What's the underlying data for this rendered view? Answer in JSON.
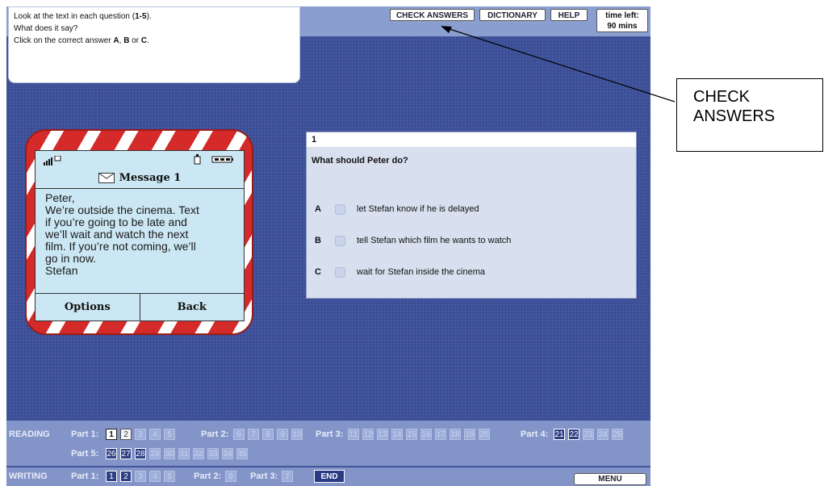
{
  "instructions": {
    "line1_pre": "Look at the text in each question (",
    "line1_bold": "1-5",
    "line1_post": ").",
    "line2": "What does it say?",
    "line3_pre": "Click on the correct answer ",
    "opt_a": "A",
    "sep1": ", ",
    "opt_b": "B",
    "sep2": " or ",
    "opt_c": "C",
    "line3_post": "."
  },
  "toolbar": {
    "check_answers": "CHECK ANSWERS",
    "dictionary": "DICTIONARY",
    "help": "HELP"
  },
  "timer": {
    "label": "time left:",
    "value": "90 mins"
  },
  "phone": {
    "title": "Message 1",
    "message_lines": [
      "Peter,",
      "We’re outside the cinema. Text",
      "if you’re going to be late and",
      "we’ll wait and watch the next",
      "film. If you’re not coming, we’ll",
      "go in now.",
      "Stefan"
    ],
    "soft_left": "Options",
    "soft_right": "Back",
    "icons": [
      "signal-icon",
      "envelope-icon",
      "battery-icon"
    ]
  },
  "question": {
    "number": "1",
    "text": "What should Peter do?",
    "options": [
      {
        "letter": "A",
        "text": "let Stefan know if he is delayed"
      },
      {
        "letter": "B",
        "text": "tell Stefan which film he wants to watch"
      },
      {
        "letter": "C",
        "text": "wait for Stefan inside the cinema"
      }
    ]
  },
  "nav": {
    "reading_label": "READING",
    "writing_label": "WRITING",
    "reading_parts": {
      "part1": {
        "label": "Part 1:",
        "items": [
          "1",
          "2",
          "3",
          "4",
          "5"
        ],
        "current": "1",
        "answered": [
          "2"
        ]
      },
      "part2": {
        "label": "Part 2:",
        "items": [
          "6",
          "7",
          "8",
          "9",
          "10"
        ]
      },
      "part3": {
        "label": "Part 3:",
        "items": [
          "11",
          "12",
          "13",
          "14",
          "15",
          "16",
          "17",
          "18",
          "19",
          "20"
        ]
      },
      "part4": {
        "label": "Part 4:",
        "items": [
          "21",
          "22",
          "23",
          "24",
          "25"
        ],
        "dark": [
          "21",
          "22"
        ]
      },
      "part5": {
        "label": "Part 5:",
        "items": [
          "26",
          "27",
          "28",
          "29",
          "30",
          "31",
          "32",
          "33",
          "34",
          "35"
        ],
        "dark": [
          "26",
          "27",
          "28"
        ]
      }
    },
    "writing_parts": {
      "part1": {
        "label": "Part 1:",
        "items": [
          "1",
          "2",
          "3",
          "4",
          "5"
        ],
        "dark": [
          "1",
          "2"
        ]
      },
      "part2": {
        "label": "Part 2:",
        "items": [
          "6"
        ]
      },
      "part3": {
        "label": "Part 3:",
        "items": [
          "7"
        ]
      }
    },
    "end": "END",
    "menu": "MENU"
  },
  "callout": {
    "line1": "CHECK",
    "line2": "ANSWERS"
  }
}
